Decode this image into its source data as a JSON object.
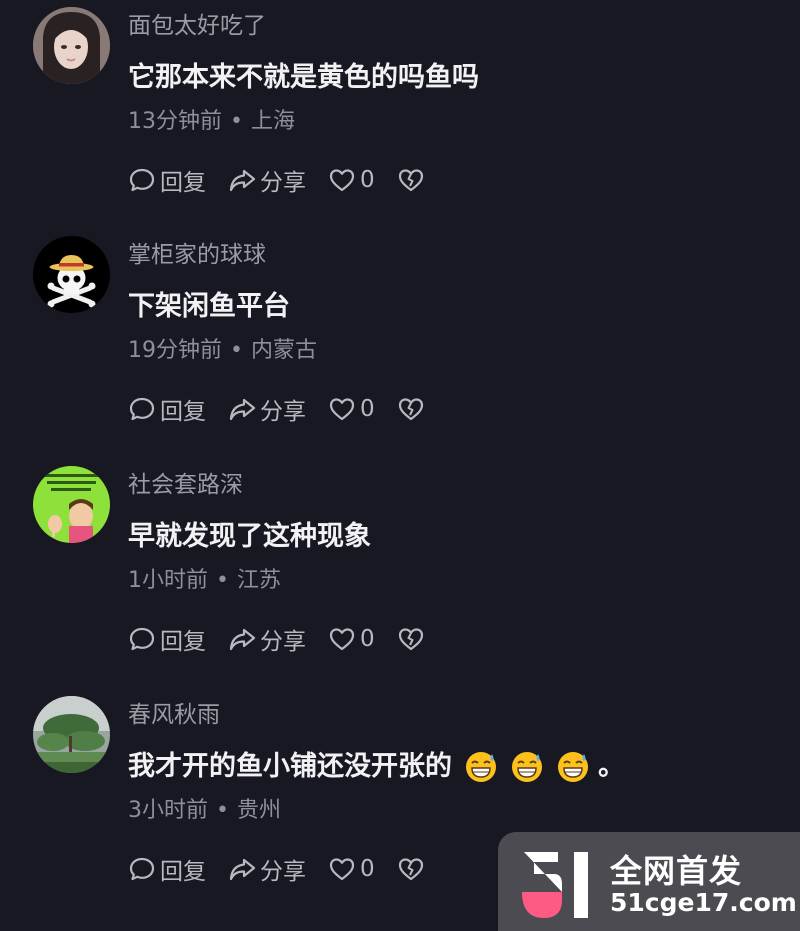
{
  "comments": [
    {
      "username": "面包太好吃了",
      "content": "它那本来不就是黄色的吗鱼吗",
      "time": "13分钟前",
      "separator": "•",
      "location": "上海",
      "reply_label": "回复",
      "share_label": "分享",
      "like_count": "0",
      "avatar": "avatar-girl-photo"
    },
    {
      "username": "掌柜家的球球",
      "content": "下架闲鱼平台",
      "time": "19分钟前",
      "separator": "•",
      "location": "内蒙古",
      "reply_label": "回复",
      "share_label": "分享",
      "like_count": "0",
      "avatar": "avatar-skull-strawhat"
    },
    {
      "username": "社会套路深",
      "content": "早就发现了这种现象",
      "time": "1小时前",
      "separator": "•",
      "location": "江苏",
      "reply_label": "回复",
      "share_label": "分享",
      "like_count": "0",
      "avatar": "avatar-green-cartoon"
    },
    {
      "username": "春风秋雨",
      "content": "我才开的鱼小铺还没开张的",
      "content_suffix": "。",
      "time": "3小时前",
      "separator": "•",
      "location": "贵州",
      "reply_label": "回复",
      "share_label": "分享",
      "like_count": "0",
      "avatar": "avatar-landscape-tree"
    }
  ],
  "watermark": {
    "line1": "全网首发",
    "line2": "51cge17.com"
  },
  "icons": {
    "reply": "reply-bubble-icon",
    "share": "share-arrow-icon",
    "like": "heart-icon",
    "dislike": "broken-heart-icon",
    "emoji": "grinning-sweat-emoji"
  },
  "colors": {
    "background": "#171821",
    "username": "#9a9ba4",
    "content": "#f2f2f5",
    "meta": "#8e8f99",
    "actions": "#b7b8c0"
  }
}
